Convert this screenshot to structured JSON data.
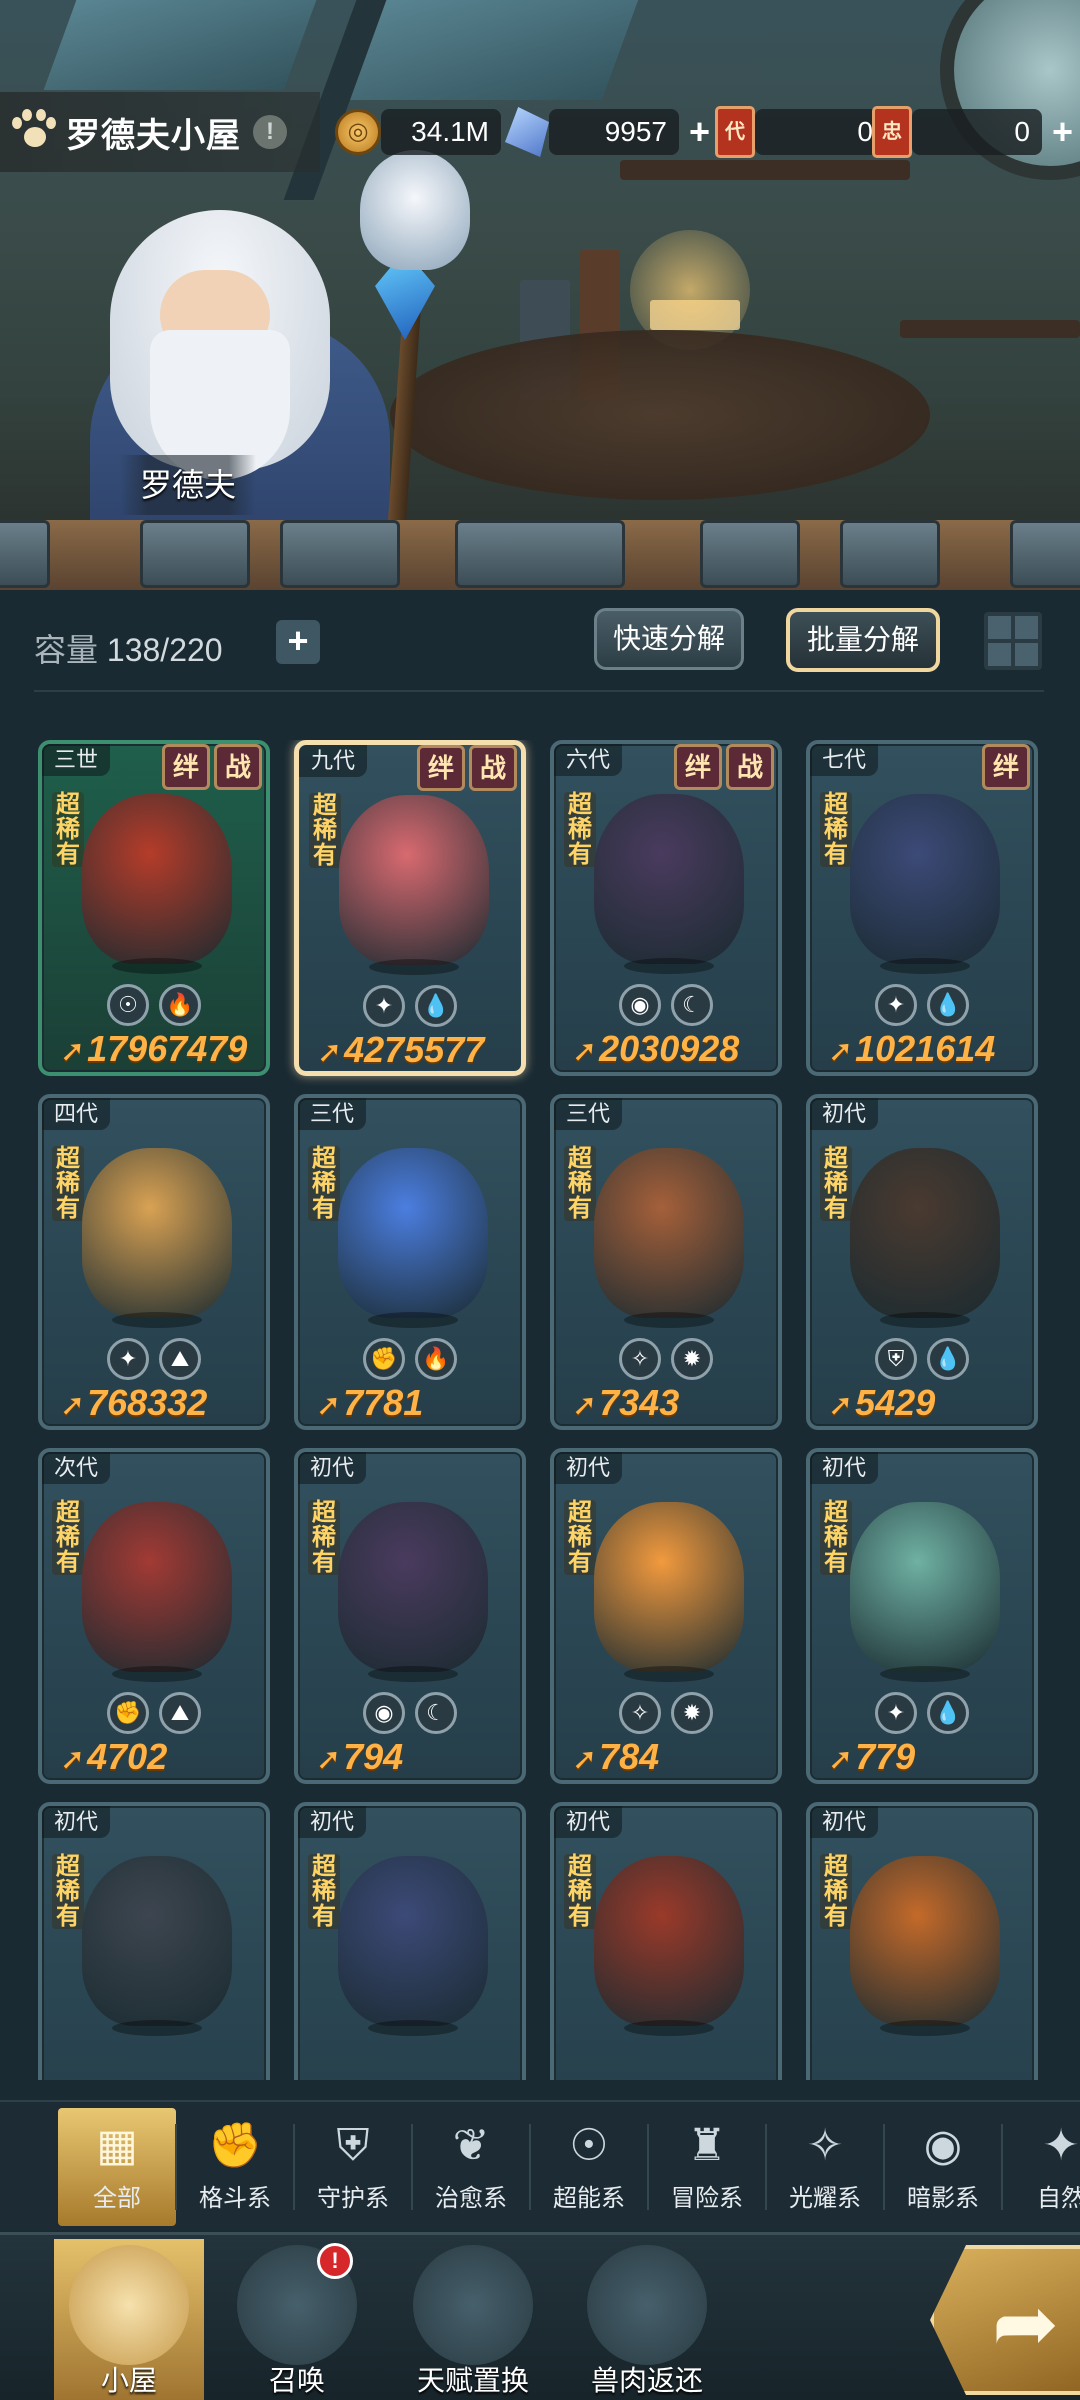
{
  "header": {
    "title": "罗德夫小屋",
    "info": "!",
    "npc_name": "罗德夫",
    "resources": {
      "gold": "34.1M",
      "crystal": "9957",
      "ticket1": "0",
      "ticket2": "0",
      "ticket1_glyph": "代",
      "ticket2_glyph": "忠",
      "plus": "+"
    }
  },
  "inventory": {
    "capacity_label": "容量",
    "capacity_value": "138/220",
    "plus": "+",
    "quick_decompose": "快速分解",
    "batch_decompose": "批量分解",
    "rarity_text": "超稀有",
    "tag_bond": "绊",
    "tag_battle": "战",
    "cards": [
      {
        "gen": "三世",
        "power": "17967479",
        "e1": "☉",
        "e2": "🔥",
        "tags": [
          "bond",
          "battle"
        ],
        "color": "#b53c2a",
        "style": "green"
      },
      {
        "gen": "九代",
        "power": "4275577",
        "e1": "✦",
        "e2": "💧",
        "tags": [
          "bond",
          "battle"
        ],
        "color": "#d86a70",
        "style": "selected"
      },
      {
        "gen": "六代",
        "power": "2030928",
        "e1": "◉",
        "e2": "☾",
        "tags": [
          "bond",
          "battle"
        ],
        "color": "#4a3b5e",
        "style": ""
      },
      {
        "gen": "七代",
        "power": "1021614",
        "e1": "✦",
        "e2": "💧",
        "tags": [
          "bond"
        ],
        "color": "#3c4a78",
        "style": ""
      },
      {
        "gen": "四代",
        "power": "768332",
        "e1": "✦",
        "e2": "⛰",
        "tags": [],
        "color": "#d9a253",
        "style": ""
      },
      {
        "gen": "三代",
        "power": "7781",
        "e1": "✊",
        "e2": "🔥",
        "tags": [],
        "color": "#4b7ee0",
        "style": ""
      },
      {
        "gen": "三代",
        "power": "7343",
        "e1": "✧",
        "e2": "✹",
        "tags": [],
        "color": "#a5603a",
        "style": ""
      },
      {
        "gen": "初代",
        "power": "5429",
        "e1": "⛨",
        "e2": "💧",
        "tags": [],
        "color": "#4a3a30",
        "style": ""
      },
      {
        "gen": "次代",
        "power": "4702",
        "e1": "✊",
        "e2": "⛰",
        "tags": [],
        "color": "#a23a34",
        "style": ""
      },
      {
        "gen": "初代",
        "power": "794",
        "e1": "◉",
        "e2": "☾",
        "tags": [],
        "color": "#4a3b5e",
        "style": ""
      },
      {
        "gen": "初代",
        "power": "784",
        "e1": "✧",
        "e2": "✹",
        "tags": [],
        "color": "#f29a3e",
        "style": ""
      },
      {
        "gen": "初代",
        "power": "779",
        "e1": "✦",
        "e2": "💧",
        "tags": [],
        "color": "#6fb1a3",
        "style": ""
      },
      {
        "gen": "初代",
        "power": "",
        "e1": "",
        "e2": "",
        "tags": [],
        "color": "#3d4650",
        "style": ""
      },
      {
        "gen": "初代",
        "power": "",
        "e1": "",
        "e2": "",
        "tags": [],
        "color": "#3c4a78",
        "style": ""
      },
      {
        "gen": "初代",
        "power": "",
        "e1": "",
        "e2": "",
        "tags": [],
        "color": "#9a3a2a",
        "style": ""
      },
      {
        "gen": "初代",
        "power": "",
        "e1": "",
        "e2": "",
        "tags": [],
        "color": "#c46a2a",
        "style": ""
      }
    ]
  },
  "tabs": [
    {
      "label": "全部",
      "icon": "▦"
    },
    {
      "label": "格斗系",
      "icon": "✊"
    },
    {
      "label": "守护系",
      "icon": "⛨"
    },
    {
      "label": "治愈系",
      "icon": "❦"
    },
    {
      "label": "超能系",
      "icon": "☉"
    },
    {
      "label": "冒险系",
      "icon": "♜"
    },
    {
      "label": "光耀系",
      "icon": "✧"
    },
    {
      "label": "暗影系",
      "icon": "◉"
    },
    {
      "label": "自然",
      "icon": "✦"
    }
  ],
  "bottom_nav": [
    {
      "label": "小屋"
    },
    {
      "label": "召唤",
      "badge": "!"
    },
    {
      "label": "天赋置换"
    },
    {
      "label": "兽肉返还"
    }
  ],
  "colors": {
    "accent_gold": "#e8c772",
    "power_orange": "#ffb347",
    "rarity_yellow": "#ffd466",
    "panel_bg": "#1a2a33"
  }
}
